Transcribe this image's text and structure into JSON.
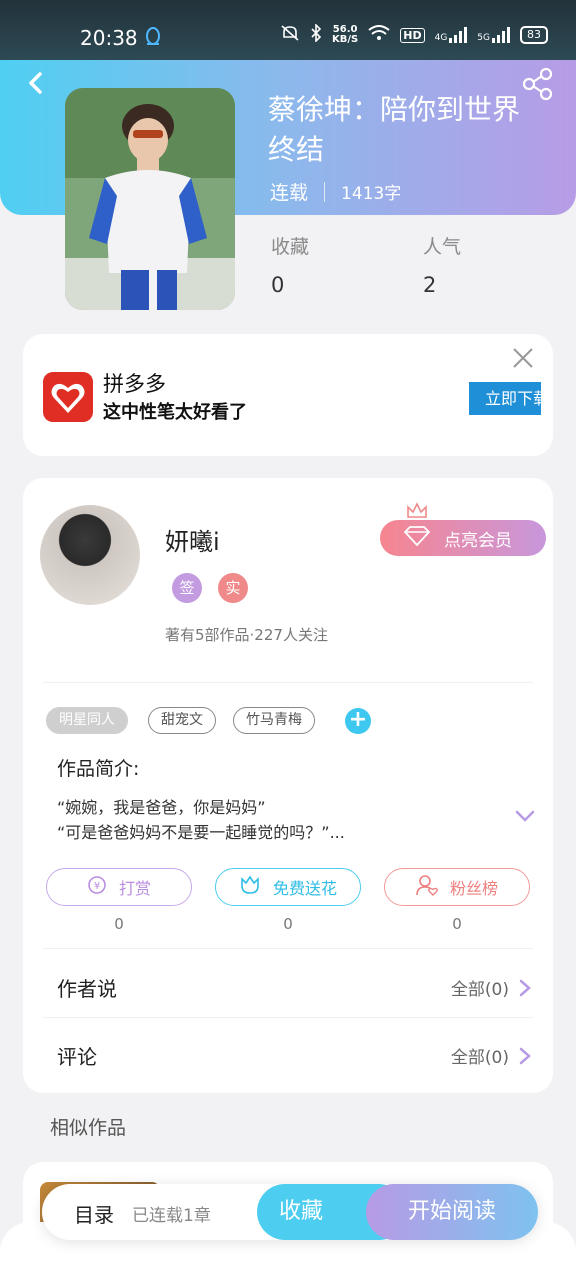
{
  "status_bar": {
    "time": "20:38",
    "speed_value": "56.0",
    "speed_unit": "KB/S",
    "hd_label": "HD",
    "net_4g": "4G",
    "net_5g": "5G",
    "battery": "83"
  },
  "book": {
    "title": "蔡徐坤：陪你到世界终结",
    "status": "连载",
    "word_count": "1413字",
    "favorites_label": "收藏",
    "favorites_value": "0",
    "popularity_label": "人气",
    "popularity_value": "2"
  },
  "ad": {
    "brand": "拼多多",
    "text": "这中性笔太好看了",
    "cta": "立即下载"
  },
  "author": {
    "name": "妍曦i",
    "badge_sign": "签",
    "badge_real": "实",
    "info": "著有5部作品·227人关注",
    "vip_button": "点亮会员"
  },
  "tags": [
    "明星同人",
    "甜宠文",
    "竹马青梅"
  ],
  "intro": {
    "label": "作品简介:",
    "line1": "“婉婉，我是爸爸，你是妈妈”",
    "line2": "“可是爸爸妈妈不是要一起睡觉的吗？”..."
  },
  "actions": [
    {
      "label": "打赏",
      "count": "0"
    },
    {
      "label": "免费送花",
      "count": "0"
    },
    {
      "label": "粉丝榜",
      "count": "0"
    }
  ],
  "author_says": {
    "label": "作者说",
    "right": "全部(0)"
  },
  "comments": {
    "label": "评论",
    "right": "全部(0)"
  },
  "similar": {
    "title": "相似作品"
  },
  "bottom_bar": {
    "toc": "目录",
    "progress": "已连载1章",
    "favorite": "收藏",
    "read": "开始阅读"
  },
  "colors": {
    "header_gradient_start": "#4fcff2",
    "header_gradient_end": "#b79ce6",
    "accent_cyan": "#3ec7ef",
    "accent_purple": "#b79be5",
    "pdd_red": "#e02e24"
  }
}
